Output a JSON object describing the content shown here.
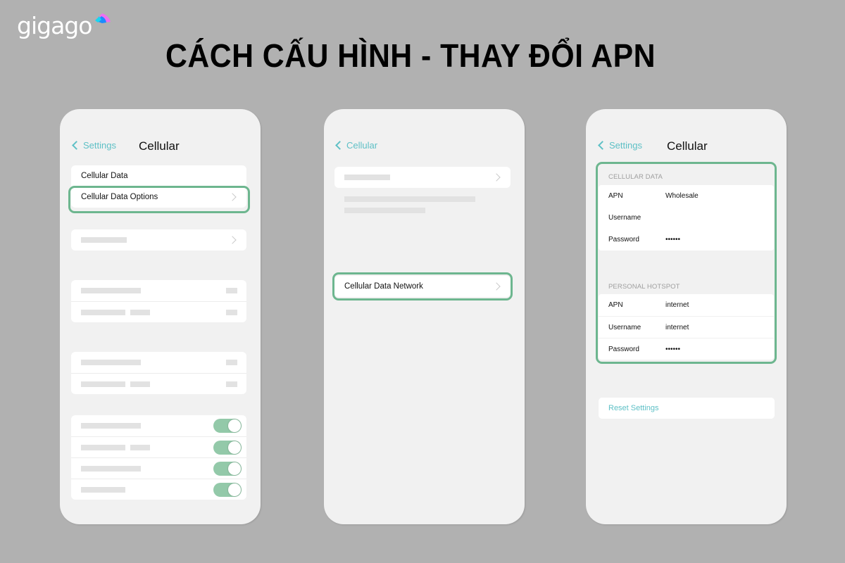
{
  "brand": {
    "logo_text": "gigago",
    "colors": {
      "accent_green": "#6db68f",
      "toggle_green": "#93c9a9",
      "link_teal": "#5ec0c6",
      "background": "#b1b1b1",
      "logo_cyan": "#19d6f0",
      "logo_blue": "#1a8cff",
      "logo_pink": "#ee6ff0"
    }
  },
  "headline": "CÁCH CẤU HÌNH - THAY ĐỔI APN",
  "phones": [
    {
      "nav": {
        "back_label": "Settings",
        "title": "Cellular"
      },
      "rows": {
        "cellular_data": "Cellular Data",
        "cellular_data_options": "Cellular Data Options"
      },
      "toggles": [
        {
          "on": true
        },
        {
          "on": true
        },
        {
          "on": true
        },
        {
          "on": true
        }
      ]
    },
    {
      "nav": {
        "back_label": "Cellular"
      },
      "rows": {
        "cellular_data_network": "Cellular Data Network"
      }
    },
    {
      "nav": {
        "back_label": "Settings",
        "title": "Cellular"
      },
      "cellular_data": {
        "header": "CELLULAR DATA",
        "fields": [
          {
            "label": "APN",
            "value": "Wholesale"
          },
          {
            "label": "Username",
            "value": ""
          },
          {
            "label": "Password",
            "value": "••••••"
          }
        ]
      },
      "personal_hotspot": {
        "header": "PERSONAL HOTSPOT",
        "fields": [
          {
            "label": "APN",
            "value": "internet"
          },
          {
            "label": "Username",
            "value": "internet"
          },
          {
            "label": "Password",
            "value": "••••••"
          }
        ]
      },
      "reset_label": "Reset Settings"
    }
  ]
}
